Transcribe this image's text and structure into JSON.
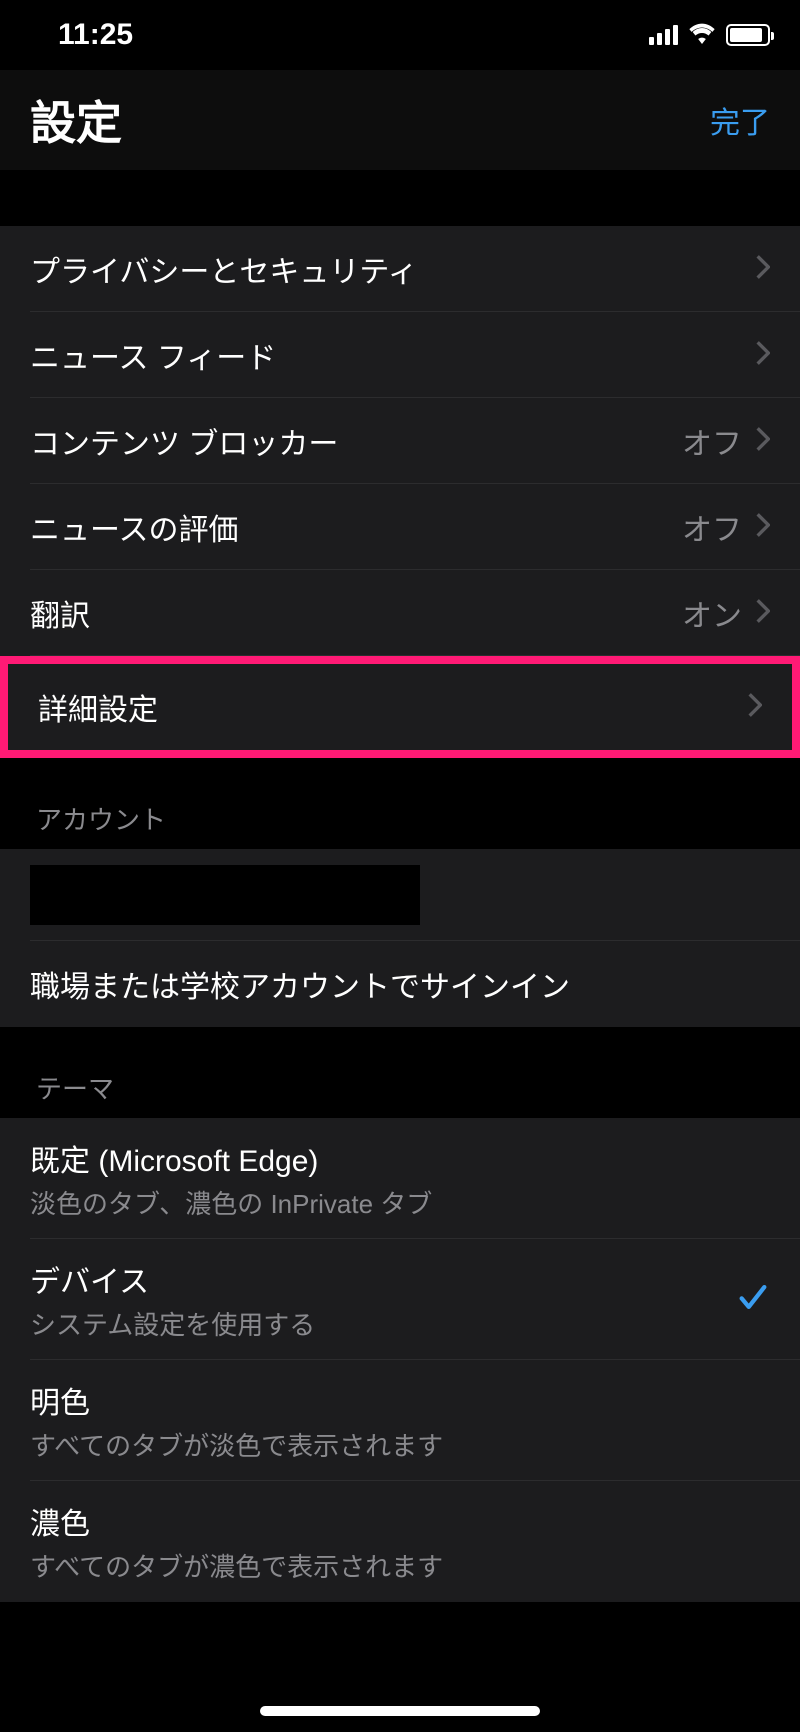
{
  "status": {
    "time": "11:25"
  },
  "nav": {
    "title": "設定",
    "done": "完了"
  },
  "settings": {
    "privacy": "プライバシーとセキュリティ",
    "newsFeed": "ニュース フィード",
    "contentBlocker": "コンテンツ ブロッカー",
    "contentBlockerValue": "オフ",
    "newsRating": "ニュースの評価",
    "newsRatingValue": "オフ",
    "translate": "翻訳",
    "translateValue": "オン",
    "advanced": "詳細設定"
  },
  "account": {
    "header": "アカウント",
    "signin": "職場または学校アカウントでサインイン"
  },
  "theme": {
    "header": "テーマ",
    "default": {
      "title": "既定 (Microsoft Edge)",
      "subtitle": "淡色のタブ、濃色の InPrivate タブ"
    },
    "device": {
      "title": "デバイス",
      "subtitle": "システム設定を使用する"
    },
    "light": {
      "title": "明色",
      "subtitle": "すべてのタブが淡色で表示されます"
    },
    "dark": {
      "title": "濃色",
      "subtitle": "すべてのタブが濃色で表示されます"
    }
  }
}
